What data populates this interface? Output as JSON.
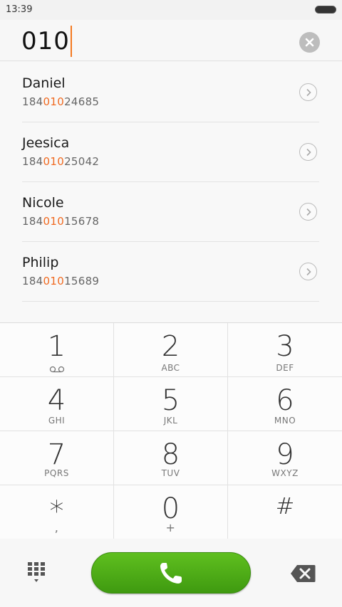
{
  "status_bar": {
    "time": "13:39"
  },
  "dial": {
    "number": "010"
  },
  "contacts": [
    {
      "name": "Daniel",
      "number_prefix": "184",
      "number_match": "010",
      "number_suffix": "24685"
    },
    {
      "name": "Jeesica",
      "number_prefix": "184",
      "number_match": "010",
      "number_suffix": "25042"
    },
    {
      "name": "Nicole",
      "number_prefix": "184",
      "number_match": "010",
      "number_suffix": "15678"
    },
    {
      "name": "Philip",
      "number_prefix": "184",
      "number_match": "010",
      "number_suffix": "15689"
    }
  ],
  "keys": [
    {
      "digit": "1",
      "sub": ""
    },
    {
      "digit": "2",
      "sub": "ABC"
    },
    {
      "digit": "3",
      "sub": "DEF"
    },
    {
      "digit": "4",
      "sub": "GHI"
    },
    {
      "digit": "5",
      "sub": "JKL"
    },
    {
      "digit": "6",
      "sub": "MNO"
    },
    {
      "digit": "7",
      "sub": "PQRS"
    },
    {
      "digit": "8",
      "sub": "TUV"
    },
    {
      "digit": "9",
      "sub": "WXYZ"
    },
    {
      "digit": "*",
      "sub": ","
    },
    {
      "digit": "0",
      "sub": "+"
    },
    {
      "digit": "#",
      "sub": ""
    }
  ],
  "icons": {
    "clear": "clear-icon",
    "detail": "chevron-right-icon",
    "voicemail": "voicemail-icon",
    "dialpad": "dialpad-icon",
    "call": "phone-icon",
    "backspace": "backspace-icon"
  },
  "colors": {
    "highlight": "#f06a21",
    "cursor": "#f47a21",
    "call_button": "#4caf17"
  }
}
